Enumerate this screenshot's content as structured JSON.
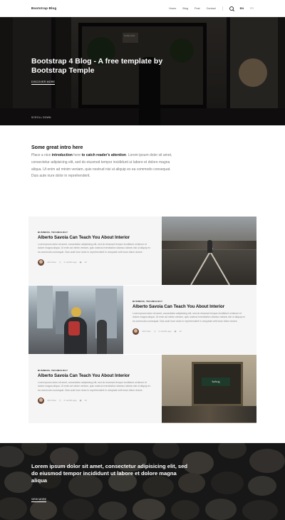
{
  "nav": {
    "brand": "Bootstrap Blog",
    "items": [
      "Home",
      "Blog",
      "Post",
      "Contact"
    ],
    "languages": [
      "EN",
      "FR"
    ]
  },
  "hero": {
    "title": "Bootstrap 4 Blog - A free template by Bootstrap Temple",
    "cta": "DISCOVER MORE",
    "scroll": "SCROLL DOWN",
    "sign": "Corky Lane"
  },
  "intro": {
    "heading": "Some great intro here",
    "pre1": "Place a nice ",
    "bold1": "introduction",
    "mid": " here ",
    "bold2": "to catch reader's attention",
    "rest": ". Lorem ipsum dolor sit amet, consectetur adipisicing elit, sed do eiusmod tempor incididunt ut labore et dolore magna aliqua. Ut enim ad minim veniam, quis nostrud nisi ut aliquip ex ea commodo consequat. Duis aute irure dolor in reprehenderit."
  },
  "posts": [
    {
      "category": "BUSINESS, TECHNOLOGY",
      "title": "Alberto Savoia Can Teach You About Interior",
      "excerpt": "Lorem ipsum dolor sit amet, consectetur adipisicing elit, sed do eiusmod tempor incididunt ut labore et dolore magna aliqua. Ut enim ad minim veniam, quis nostrud exercitation ullamco laboris nisi ut aliquip ex ea commodo consequat. Duis aute irure dolor in reprehenderit in voluptate velit esse cillum dolore.",
      "author": "John Doe",
      "time": "2 months ago",
      "comments": "12"
    },
    {
      "category": "BUSINESS, TECHNOLOGY",
      "title": "Alberto Savoia Can Teach You About Interior",
      "excerpt": "Lorem ipsum dolor sit amet, consectetur adipisicing elit, sed do eiusmod tempor incididunt ut labore et dolore magna aliqua. Ut enim ad minim veniam, quis nostrud exercitation ullamco laboris nisi ut aliquip ex ea commodo consequat. Duis aute irure dolor in reprehenderit in voluptate velit esse cillum dolore.",
      "author": "John Doe",
      "time": "2 months ago",
      "comments": "12"
    },
    {
      "category": "BUSINESS, TECHNOLOGY",
      "title": "Alberto Savoia Can Teach You About Interior",
      "excerpt": "Lorem ipsum dolor sit amet, consectetur adipisicing elit, sed do eiusmod tempor incididunt ut labore et dolore magna aliqua. Ut enim ad minim veniam, quis nostrud exercitation ullamco laboris nisi ut aliquip ex ea commodo consequat. Duis aute irure dolor in reprehenderit in voluptate velit esse cillum dolore.",
      "author": "John Doe",
      "time": "2 months ago",
      "comments": "12"
    }
  ],
  "shop_sign": "ludwig",
  "divider": {
    "text": "Lorem ipsum dolor sit amet, consectetur adipisicing elit, sed do eiusmod tempor incididunt ut labore et dolore magna aliqua",
    "cta": "VIEW MORE"
  },
  "icons": [
    "search-icon",
    "clock-icon",
    "comment-icon"
  ]
}
